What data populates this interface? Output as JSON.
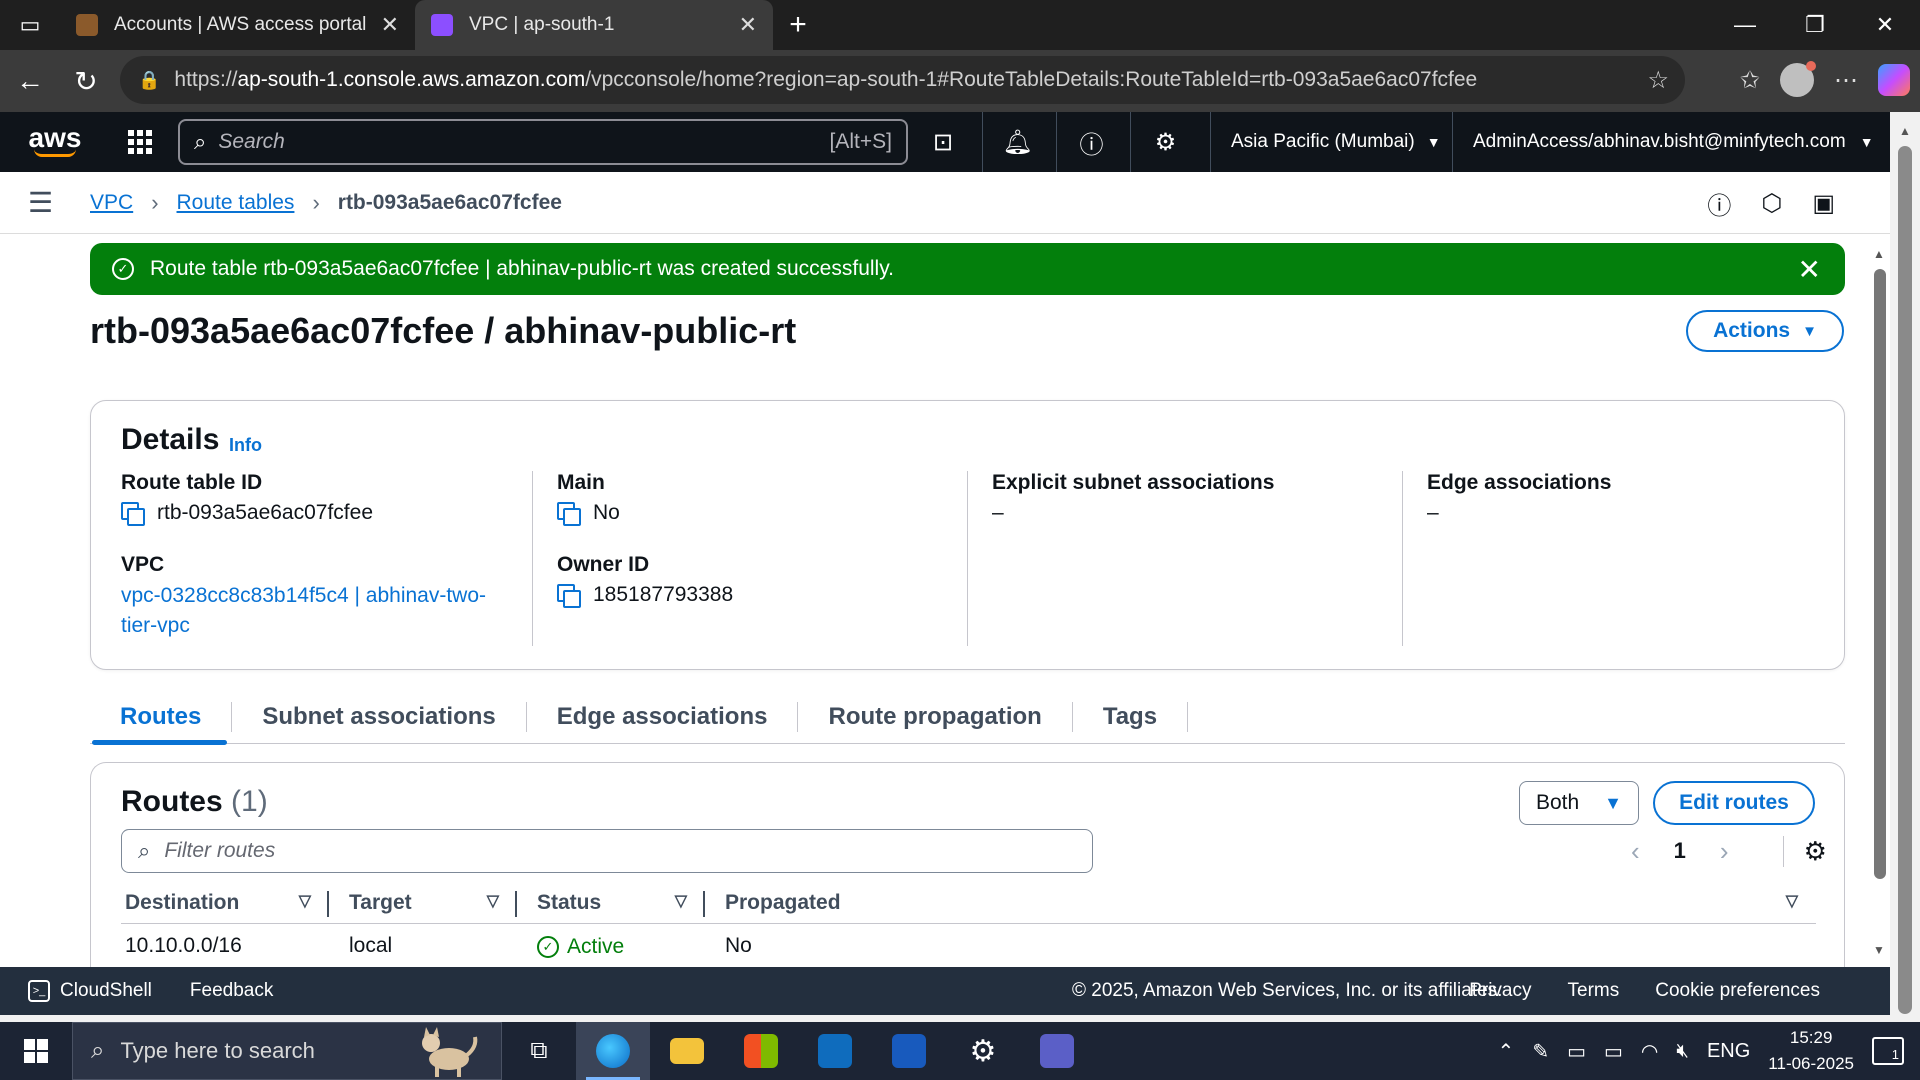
{
  "browser": {
    "tabs": [
      {
        "title": "Accounts | AWS access portal",
        "active": false
      },
      {
        "title": "VPC | ap-south-1",
        "active": true
      }
    ],
    "url_prefix": "https://",
    "url_host": "ap-south-1.console.aws.amazon.com",
    "url_path": "/vpcconsole/home?region=ap-south-1#RouteTableDetails:RouteTableId=rtb-093a5ae6ac07fcfee"
  },
  "aws_nav": {
    "logo": "aws",
    "search_placeholder": "Search",
    "search_shortcut": "[Alt+S]",
    "region": "Asia Pacific (Mumbai)",
    "account": "AdminAccess/abhinav.bisht@minfytech.com"
  },
  "breadcrumb": {
    "items": [
      "VPC",
      "Route tables"
    ],
    "current": "rtb-093a5ae6ac07fcfee"
  },
  "flash": {
    "message": "Route table rtb-093a5ae6ac07fcfee | abhinav-public-rt was created successfully.",
    "color": "#037f0c"
  },
  "page": {
    "title": "rtb-093a5ae6ac07fcfee / abhinav-public-rt",
    "actions_label": "Actions"
  },
  "details": {
    "heading": "Details",
    "info_label": "Info",
    "route_table_id_label": "Route table ID",
    "route_table_id": "rtb-093a5ae6ac07fcfee",
    "vpc_label": "VPC",
    "vpc_value": "vpc-0328cc8c83b14f5c4 | abhinav-two-tier-vpc",
    "main_label": "Main",
    "main_value": "No",
    "owner_label": "Owner ID",
    "owner_value": "185187793388",
    "explicit_label": "Explicit subnet associations",
    "explicit_value": "–",
    "edge_label": "Edge associations",
    "edge_value": "–"
  },
  "tabs": [
    "Routes",
    "Subnet associations",
    "Edge associations",
    "Route propagation",
    "Tags"
  ],
  "routes": {
    "heading": "Routes",
    "count": "(1)",
    "filter_select": "Both",
    "edit_label": "Edit routes",
    "filter_placeholder": "Filter routes",
    "page_number": "1",
    "columns": [
      "Destination",
      "Target",
      "Status",
      "Propagated"
    ],
    "rows": [
      {
        "destination": "10.10.0.0/16",
        "target": "local",
        "status": "Active",
        "propagated": "No"
      }
    ]
  },
  "footer": {
    "cloudshell": "CloudShell",
    "feedback": "Feedback",
    "copyright": "© 2025, Amazon Web Services, Inc. or its affiliates.",
    "links": [
      "Privacy",
      "Terms",
      "Cookie preferences"
    ]
  },
  "taskbar": {
    "search_placeholder": "Type here to search",
    "language": "ENG",
    "time": "15:29",
    "date": "11-06-2025",
    "notification_count": "1"
  },
  "colors": {
    "aws_blue": "#0972d3",
    "aws_nav_bg": "#0f141a",
    "success_green": "#037f0c",
    "footer_bg": "#232f3e"
  }
}
